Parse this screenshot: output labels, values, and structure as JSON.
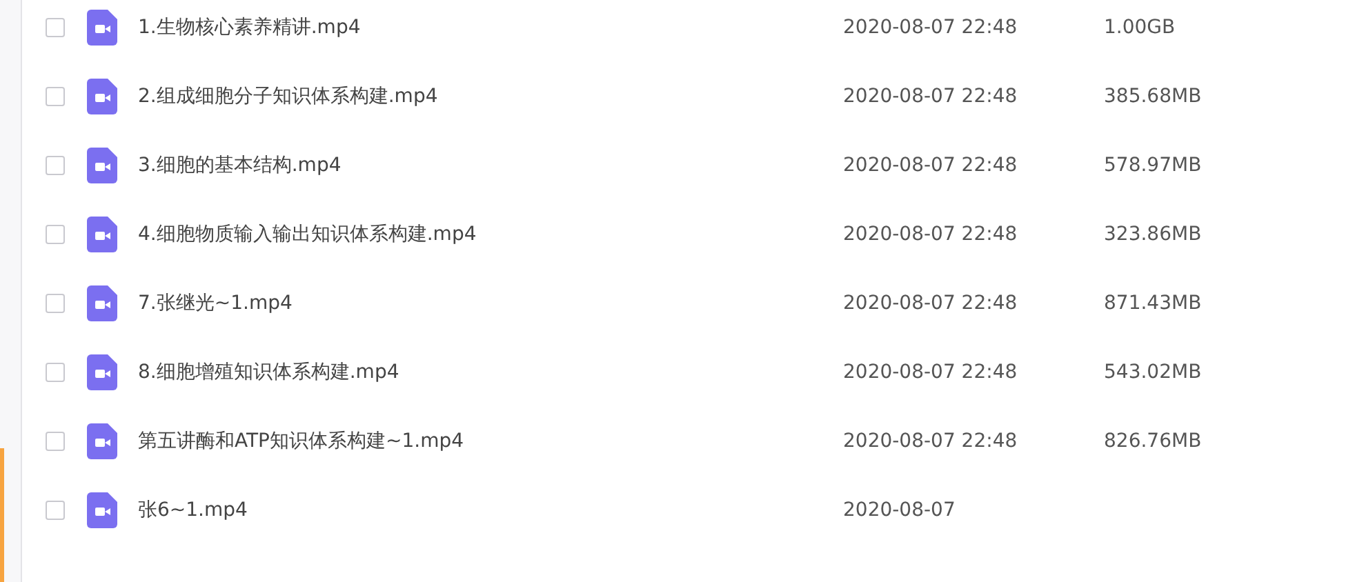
{
  "files": [
    {
      "name": "1.生物核心素养精讲.mp4",
      "checked": false,
      "modified": "2020-08-07 22:48",
      "size": "1.00GB"
    },
    {
      "name": "2.组成细胞分子知识体系构建.mp4",
      "checked": false,
      "modified": "2020-08-07 22:48",
      "size": "385.68MB"
    },
    {
      "name": "3.细胞的基本结构.mp4",
      "checked": false,
      "modified": "2020-08-07 22:48",
      "size": "578.97MB"
    },
    {
      "name": "4.细胞物质输入输出知识体系构建.mp4",
      "checked": false,
      "modified": "2020-08-07 22:48",
      "size": "323.86MB"
    },
    {
      "name": "7.张继光~1.mp4",
      "checked": false,
      "modified": "2020-08-07 22:48",
      "size": "871.43MB"
    },
    {
      "name": "8.细胞增殖知识体系构建.mp4",
      "checked": false,
      "modified": "2020-08-07 22:48",
      "size": "543.02MB"
    },
    {
      "name": "第五讲酶和ATP知识体系构建~1.mp4",
      "checked": false,
      "modified": "2020-08-07 22:48",
      "size": "826.76MB"
    },
    {
      "name": "张6~1.mp4",
      "checked": false,
      "modified": "2020-08-07"
    }
  ]
}
